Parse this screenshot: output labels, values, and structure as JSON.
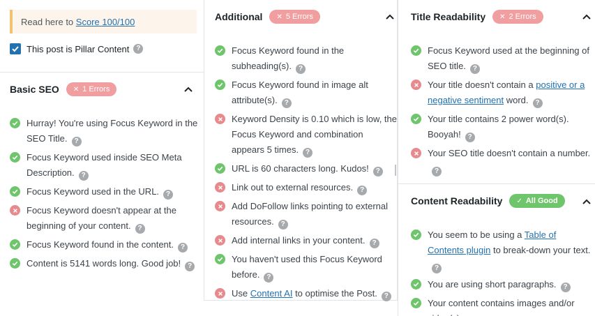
{
  "notice": {
    "prefix": "Read here to ",
    "link": "Score 100/100"
  },
  "pillar": {
    "label": "This post is Pillar Content",
    "checked": true
  },
  "basic_seo": {
    "title": "Basic SEO",
    "badge": "1 Errors",
    "items": [
      {
        "status": "pass",
        "text": "Hurray! You're using Focus Keyword in the SEO Title."
      },
      {
        "status": "pass",
        "text": "Focus Keyword used inside SEO Meta Description."
      },
      {
        "status": "pass",
        "text": "Focus Keyword used in the URL."
      },
      {
        "status": "fail",
        "text": "Focus Keyword doesn't appear at the beginning of your content."
      },
      {
        "status": "pass",
        "text": "Focus Keyword found in the content."
      },
      {
        "status": "pass",
        "text": "Content is 5141 words long. Good job!"
      }
    ]
  },
  "additional": {
    "title": "Additional",
    "badge": "5 Errors",
    "items": [
      {
        "status": "pass",
        "text": "Focus Keyword found in the subheading(s)."
      },
      {
        "status": "pass",
        "text": "Focus Keyword found in image alt attribute(s)."
      },
      {
        "status": "fail",
        "text": "Keyword Density is 0.10 which is low, the Focus Keyword and combination appears 5 times."
      },
      {
        "status": "pass",
        "text": "URL is 60 characters long. Kudos!"
      },
      {
        "status": "fail",
        "text": "Link out to external resources."
      },
      {
        "status": "fail",
        "text": "Add DoFollow links pointing to external resources."
      },
      {
        "status": "fail",
        "text": "Add internal links in your content."
      },
      {
        "status": "pass",
        "text": "You haven't used this Focus Keyword before."
      },
      {
        "status": "fail",
        "pre": "Use ",
        "link": "Content AI",
        "post": " to optimise the Post."
      }
    ]
  },
  "title_readability": {
    "title": "Title Readability",
    "badge": "2 Errors",
    "items": [
      {
        "status": "pass",
        "text": "Focus Keyword used at the beginning of SEO title."
      },
      {
        "status": "fail",
        "pre": "Your title doesn't contain a ",
        "link": "positive or a negative sentiment",
        "post": " word."
      },
      {
        "status": "pass",
        "text": "Your title contains 2 power word(s). Booyah!"
      },
      {
        "status": "fail",
        "text": "Your SEO title doesn't contain a number."
      }
    ]
  },
  "content_readability": {
    "title": "Content Readability",
    "badge": "All Good",
    "items": [
      {
        "status": "pass",
        "pre": "You seem to be using a ",
        "link": "Table of Contents plugin",
        "post": " to break-down your text."
      },
      {
        "status": "pass",
        "text": "You are using short paragraphs."
      },
      {
        "status": "pass",
        "text": "Your content contains images and/or video(s)."
      }
    ]
  },
  "icons": {
    "help": "question-mark-icon",
    "pass": "check-circle-icon",
    "fail": "cross-circle-icon",
    "collapse": "chevron-up-icon"
  },
  "colors": {
    "pass": "#6ec56b",
    "fail": "#e68a8d",
    "badge_error": "#f09ea0",
    "link": "#2271b1",
    "notice_border": "#f0c36d"
  }
}
